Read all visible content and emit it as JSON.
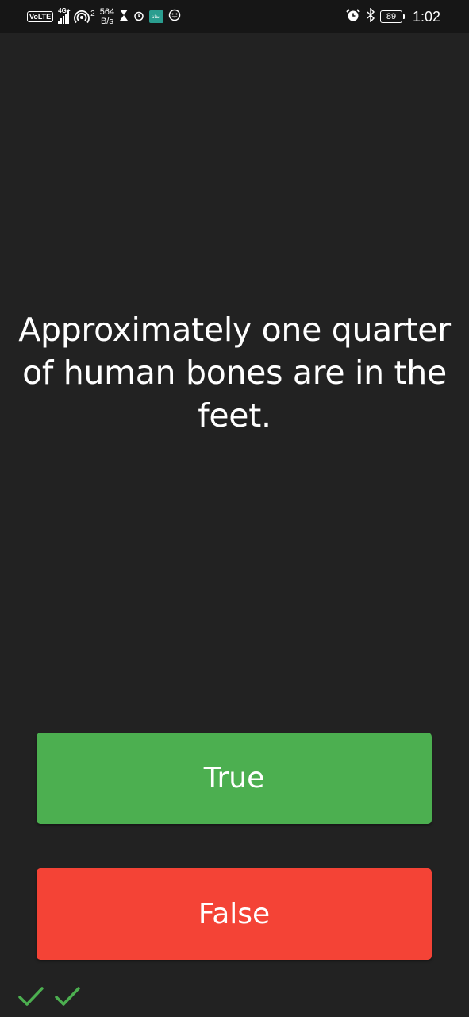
{
  "status_bar": {
    "volte": "VoLTE",
    "network": "4G+",
    "hotspot_count": "2",
    "speed_value": "564",
    "speed_unit": "B/s",
    "app_badge": "انغاذ",
    "battery": "89",
    "time": "1:02",
    "icons": [
      "volte-badge",
      "signal-icon",
      "hotspot-icon",
      "hourglass-icon",
      "alarm-icon",
      "app-badge-icon",
      "emoji-icon",
      "alarm-clock-icon",
      "bluetooth-icon",
      "battery-icon"
    ]
  },
  "question": {
    "text": "Approximately one quarter of human bones are in the feet."
  },
  "buttons": {
    "true_label": "True",
    "false_label": "False"
  },
  "colors": {
    "background": "#222222",
    "true": "#4caf50",
    "false": "#f44336",
    "check": "#4caf50"
  },
  "progress": {
    "correct_answers": 2
  }
}
